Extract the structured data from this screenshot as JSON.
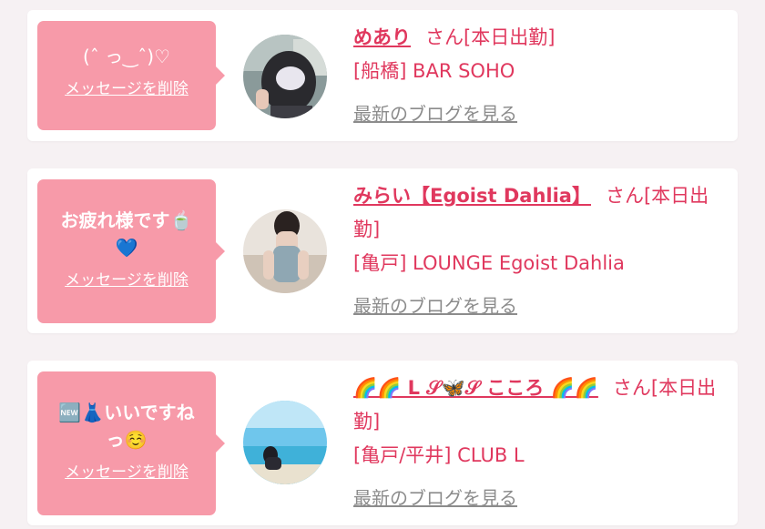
{
  "colors": {
    "accent": "#e0385e",
    "bubble": "#f79aa9",
    "background": "#f6f1f3",
    "link_gray": "#8c8c8c"
  },
  "cards": [
    {
      "message": "(ˆ っ‿ˆ)♡",
      "delete_label": "メッセージを削除",
      "name": "めあり",
      "suffix": "さん[本日出勤]",
      "shop": "[船橋] BAR SOHO",
      "blog_label": "最新のブログを見る"
    },
    {
      "message": "お疲れ様です🍵💙",
      "delete_label": "メッセージを削除",
      "name": "みらい【Egoist Dahlia】",
      "suffix": "さん[本日出勤]",
      "shop": "[亀戸] LOUNGE Egoist Dahlia",
      "blog_label": "最新のブログを見る"
    },
    {
      "message": "🆕👗いいですねっ☺️",
      "delete_label": "メッセージを削除",
      "name": "🌈🌈 L 𝒮🦋𝒮 こころ 🌈🌈",
      "suffix": "さん[本日出勤]",
      "shop": "[亀戸/平井] CLUB L",
      "blog_label": "最新のブログを見る"
    }
  ]
}
